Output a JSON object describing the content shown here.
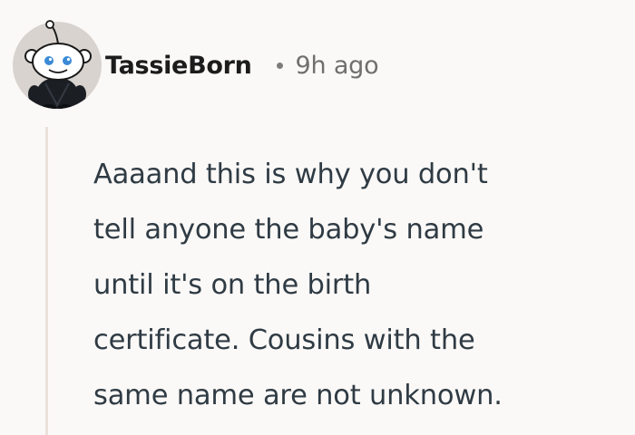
{
  "comment": {
    "author": "TassieBorn",
    "timestamp": "9h ago",
    "body_lines": [
      "Aaaand this is why you don't",
      "tell anyone the baby's name",
      "until it's on the birth",
      "certificate. Cousins with the",
      "same name are not unknown."
    ]
  },
  "colors": {
    "background": "#fbf9f7",
    "avatar_background": "#d8d3cf",
    "avatar_eye": "#3b8ad6",
    "avatar_body": "#1b1f24",
    "thread_line": "#e9e1dc"
  },
  "icons": {
    "avatar": "reddit-snoo-avatar"
  }
}
